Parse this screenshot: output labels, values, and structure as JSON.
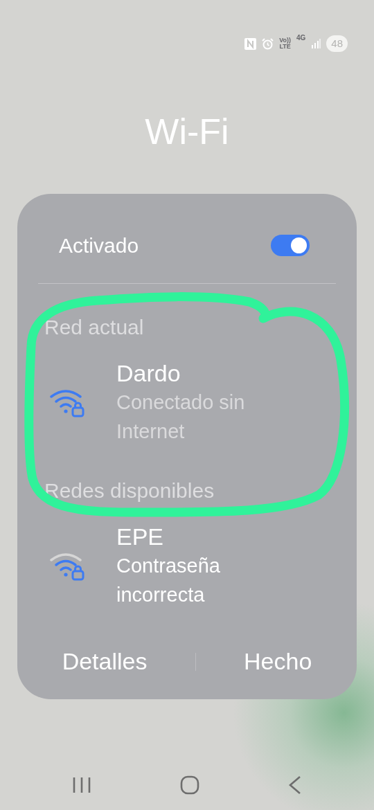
{
  "status_bar": {
    "volte": "Vo))",
    "lte": "LTE",
    "network": "4G",
    "battery": "48"
  },
  "title": "Wi-Fi",
  "toggle": {
    "label": "Activado",
    "on": true
  },
  "sections": [
    {
      "heading": "Red actual",
      "networks": [
        {
          "name": "Dardo",
          "status": "Conectado sin Internet",
          "kind": "strong"
        }
      ]
    },
    {
      "heading": "Redes disponibles",
      "networks": [
        {
          "name": "EPE",
          "status": "Contraseña incorrecta",
          "kind": "medium"
        }
      ]
    }
  ],
  "buttons": [
    "Detalles",
    "Hecho"
  ]
}
